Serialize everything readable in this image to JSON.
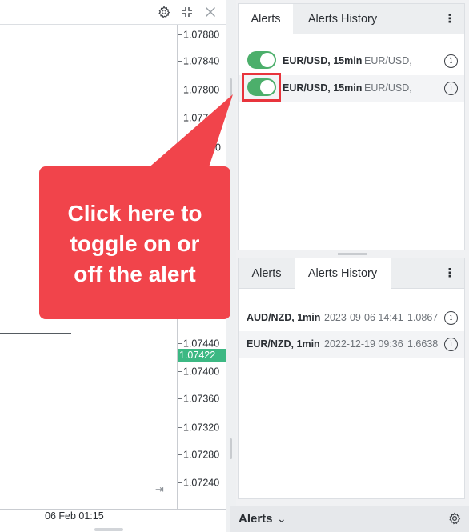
{
  "chart": {
    "price_ticks": [
      "1.07880",
      "1.07840",
      "1.07800",
      "1.077",
      "20",
      "1.07440",
      "1.07400",
      "1.07360",
      "1.07320",
      "1.07280",
      "1.07240"
    ],
    "current_price": "1.07422",
    "time_label": "06 Feb 01:15",
    "icons": {
      "settings": "gear-icon",
      "collapse": "compress-icon",
      "close": "close-icon",
      "scroll": "scroll-to-end-icon"
    }
  },
  "alerts_panel": {
    "tabs": [
      "Alerts",
      "Alerts History"
    ],
    "active_tab": "Alerts",
    "rows": [
      {
        "name": "EUR/USD, 15min",
        "detail": "EUR/USD,",
        "enabled": true
      },
      {
        "name": "EUR/USD, 15min",
        "detail": "EUR/USD,",
        "enabled": true
      }
    ]
  },
  "history_panel": {
    "tabs": [
      "Alerts",
      "Alerts History"
    ],
    "active_tab": "Alerts History",
    "rows": [
      {
        "name": "AUD/NZD, 1min",
        "time": "2023-09-06 14:41",
        "value": "1.0867"
      },
      {
        "name": "EUR/NZD, 1min",
        "time": "2022-12-19 09:36",
        "value": "1.6638"
      }
    ]
  },
  "footer": {
    "title": "Alerts"
  },
  "callout": {
    "lines": [
      "Click here to",
      "toggle on or",
      "off the alert"
    ]
  },
  "colors": {
    "toggle_on": "#4caf6b",
    "callout": "#f1444b",
    "current_price": "#3cb883",
    "highlight": "#e8343c"
  }
}
